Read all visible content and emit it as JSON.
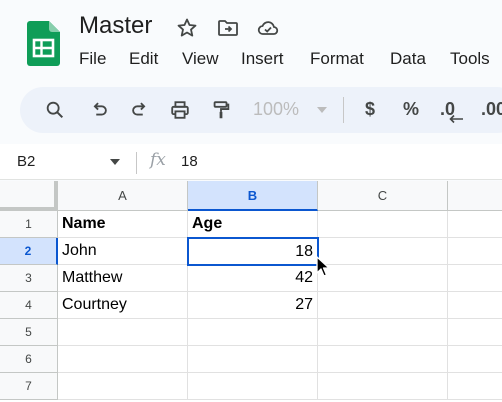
{
  "document": {
    "title": "Master",
    "title_icons": [
      "star-icon",
      "move-to-folder-icon",
      "cloud-saved-icon"
    ]
  },
  "menu": {
    "items": [
      "File",
      "Edit",
      "View",
      "Insert",
      "Format",
      "Data",
      "Tools"
    ]
  },
  "toolbar": {
    "icons": [
      "search-icon",
      "undo-icon",
      "redo-icon",
      "print-icon",
      "paint-format-icon"
    ],
    "zoom": "100%",
    "currency": "$",
    "percent": "%",
    "decrease_decimal": ".0",
    "increase_decimal": ".00"
  },
  "formula_bar": {
    "name_box": "B2",
    "fx_label": "fx",
    "formula": "18"
  },
  "sheet": {
    "columns": [
      "A",
      "B",
      "C"
    ],
    "rows": [
      "1",
      "2",
      "3",
      "4",
      "5",
      "6",
      "7"
    ],
    "selected_cell": "B2",
    "cells": {
      "A1": "Name",
      "B1": "Age",
      "A2": "John",
      "B2": "18",
      "A3": "Matthew",
      "B3": "42",
      "A4": "Courtney",
      "B4": "27"
    }
  },
  "colors": {
    "accent": "#0b57d0",
    "selection_fill": "#d3e3fd",
    "toolbar_bg": "#edf2fa",
    "logo_green": "#0f9d58"
  }
}
